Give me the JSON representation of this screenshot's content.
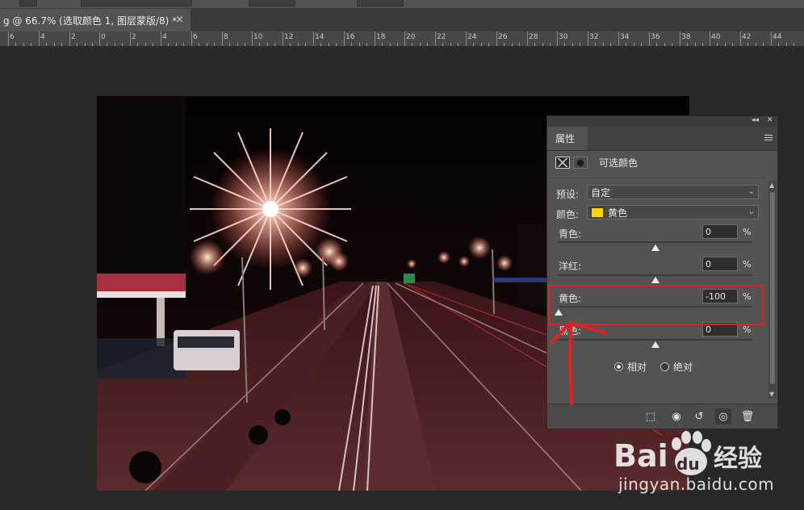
{
  "document_tab": {
    "title": "g @ 66.7% (选取颜色 1, 图层蒙版/8) *",
    "close_glyph": "×"
  },
  "ruler": {
    "labels": [
      "6",
      "4",
      "2",
      "0",
      "2",
      "4",
      "6",
      "8",
      "10",
      "12",
      "14",
      "16",
      "18",
      "20",
      "22",
      "24",
      "26",
      "28",
      "30",
      "32",
      "34",
      "36",
      "38",
      "40",
      "42",
      "44"
    ]
  },
  "properties_panel": {
    "collapse_glyph": "◂◂",
    "close_glyph": "✕",
    "tab_label": "属性",
    "adjustment_name": "可选颜色",
    "preset": {
      "label": "预设:",
      "value": "自定"
    },
    "colors": {
      "label": "颜色:",
      "value": "黄色",
      "swatch_color": "#ffd400"
    },
    "sliders": [
      {
        "label": "青色:",
        "value": "0",
        "unit": "%",
        "fraction": 0.5
      },
      {
        "label": "洋红:",
        "value": "0",
        "unit": "%",
        "fraction": 0.5
      },
      {
        "label": "黄色:",
        "value": "-100",
        "unit": "%",
        "fraction": 0.0
      },
      {
        "label": "黑色:",
        "value": "0",
        "unit": "%",
        "fraction": 0.5
      }
    ],
    "mode": {
      "relative_label": "相对",
      "absolute_label": "绝对",
      "selected": "relative"
    }
  },
  "watermark": {
    "brand": "Bai du 经验",
    "site": "jingyan.baidu.com"
  },
  "colors": {
    "highlight_box": "#e51e1e",
    "annotation_arrow": "#e51e1e"
  }
}
